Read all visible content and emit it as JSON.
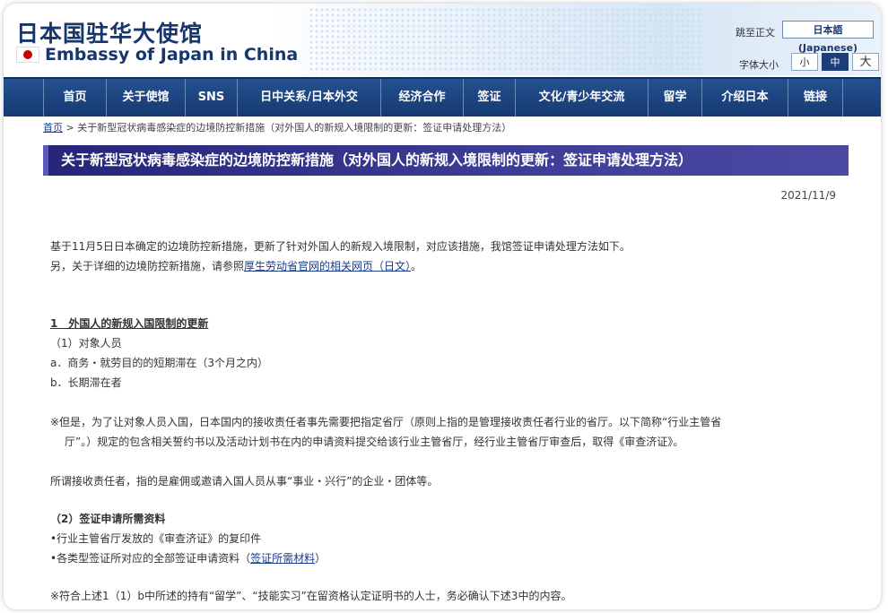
{
  "header": {
    "title_jp": "日本国驻华大使馆",
    "title_en": "Embassy of Japan in China",
    "skip_link": "跳至正文",
    "language_button": "日本語 (Japanese)",
    "font_size_label": "字体大小",
    "font_sizes": [
      "小",
      "中",
      "大"
    ],
    "colors": {
      "brand_navy": "#17366b",
      "nav_blue": "#1b3f78",
      "title_bar": "#2f2d85"
    }
  },
  "nav": {
    "items": [
      "首页",
      "关于使馆",
      "SNS",
      "日中关系/日本外交",
      "经济合作",
      "签证",
      "文化/青少年交流",
      "留学",
      "介绍日本",
      "链接"
    ]
  },
  "breadcrumb": {
    "home": "首页",
    "rest": " > 关于新型冠状病毒感染症的边境防控新措施（对外国人的新规入境限制的更新：签证申请处理方法）"
  },
  "page": {
    "title": "关于新型冠状病毒感染症的边境防控新措施（对外国人的新规入境限制的更新：签证申请处理方法）",
    "date": "2021/11/9"
  },
  "content": {
    "intro_line1": "基于11月5日日本确定的边境防控新措施，更新了针对外国人的新规入境限制，对应该措施，我馆签证申请处理方法如下。",
    "intro_line2_prefix": "另，关于详细的边境防控新措施，请参照",
    "intro_link": "厚生劳动省官网的相关网页（日文）",
    "intro_line2_suffix": "。",
    "section1_heading": "1　外国人的新规入国限制的更新",
    "s1_item1": "（1）对象人员",
    "s1_item_a": "a．商务・就劳目的的短期滞在（3个月之内）",
    "s1_item_b": "b．长期滞在者",
    "note1_line1": "※但是，为了让对象人员入国，日本国内的接收责任者事先需要把指定省厅（原则上指的是管理接收责任者行业的省厅。以下简称“行业主管省",
    "note1_line2": "厅”。）规定的包含相关誓约书以及活动计划书在内的申请资料提交给该行业主管省厅，经行业主管省厅审查后，取得《审查济证》。",
    "note2": "所谓接收责任者，指的是雇佣或邀请入国人员从事“事业・兴行”的企业・团体等。",
    "sub2_heading": "（2）签证申请所需资料",
    "sub2_item1": "•行业主管省厅发放的《审查济证》的复印件",
    "sub2_item2_prefix": "•各类型签证所对应的全部签证申请资料（",
    "sub2_item2_link": "签证所需材料",
    "sub2_item2_suffix": "）",
    "note3": "※符合上述1（1）b中所述的持有“留学”、“技能实习”在留资格认定证明书的人士，务必确认下述3中的内容。"
  }
}
